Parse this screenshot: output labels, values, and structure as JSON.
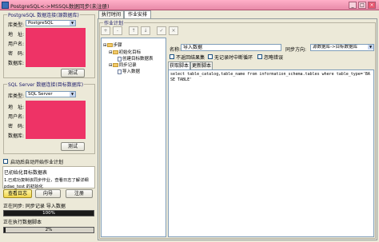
{
  "window": {
    "title": "PostgreSQL<->MSSQL数据同步(未注册)",
    "minimize": "_",
    "maximize": "□",
    "close": "×"
  },
  "source": {
    "group_title": "PostgreSQL 数据连接(源数据库)",
    "db_type_label": "库类型:",
    "db_type_value": "PostgreSQL",
    "address_label": "地　址:",
    "username_label": "用户名:",
    "password_label": "密　码:",
    "database_label": "数据库:",
    "test_button": "测试"
  },
  "target": {
    "group_title": "SQL Server 数据连接(目标数据库)",
    "db_type_label": "库类型:",
    "db_type_value": "SQL Server",
    "address_label": "地　址:",
    "username_label": "用户名:",
    "password_label": "密　码:",
    "database_label": "数据库:",
    "test_button": "测试"
  },
  "autorun_label": "启动后自动开始作业计划",
  "info": {
    "line1": "已初始化目标数据表",
    "line2": "1.已成功复制该同步作业，查看日志了解详细",
    "line3": "pdae_test 的初始化"
  },
  "actions": {
    "log_button": "查看日志",
    "wizard_button": "向导",
    "register_button": "注册"
  },
  "status": {
    "line1": "正在同步: 同步记录 导入数据",
    "progress1": "100%",
    "line2": "正在执行数据脚本",
    "progress2": "2%",
    "progress1_fraction": 1.0,
    "progress2_fraction": 0.02
  },
  "tabs": [
    {
      "label": "执行时间"
    },
    {
      "label": "作业安排"
    }
  ],
  "schedule_group_title": "作业计划",
  "toolbar": [
    "+",
    "-",
    "↑",
    "↓",
    "✓",
    "×"
  ],
  "tree": {
    "root": "步骤",
    "n1": "初始化目标",
    "n1a": "创建目标数据表",
    "n2": "同步记录",
    "n2a": "导入数据"
  },
  "step": {
    "name_label": "名称:",
    "name_value": "导入数据",
    "direction_label": "同步方向:",
    "direction_value": "源数据库->目标数据库",
    "opt1": "不返回结果集",
    "opt2": "无记录时中断循环",
    "opt3": "忽略错误"
  },
  "script_tabs": {
    "get": "获取脚本",
    "update": "更新脚本"
  },
  "sql_text": "select table_catalog,table_name from information_schema.tables where table_type='BASE TABLE'"
}
